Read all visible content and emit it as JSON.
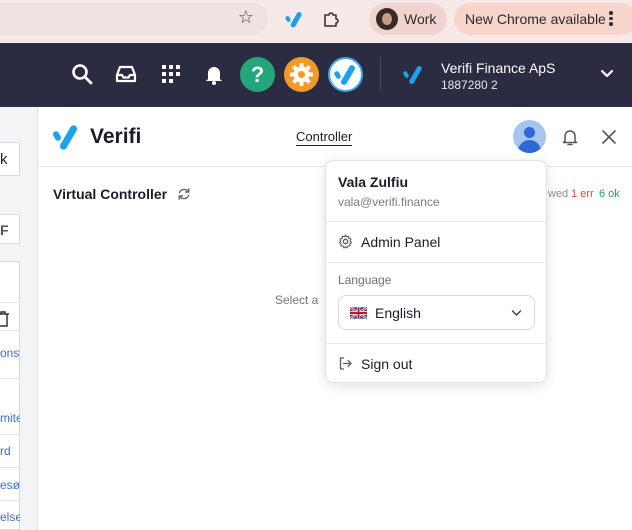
{
  "browser": {
    "profile_label": "Work",
    "update_label": "New Chrome available",
    "icons": [
      "bookmark-star-icon",
      "verifi-extension-icon",
      "extensions-puzzle-icon",
      "more-vert-icon"
    ]
  },
  "header": {
    "icons": [
      "search-icon",
      "inbox-icon",
      "apps-grid-icon",
      "bell-icon",
      "help-icon",
      "gear-icon",
      "verifi-icon"
    ],
    "help_glyph": "?",
    "company_name": "Verifi Finance ApS",
    "company_id": "1887280 2"
  },
  "left_panel": {
    "partial_texts": [
      "k",
      "F",
      "onsy",
      "mite",
      "rd",
      "esø",
      "else"
    ]
  },
  "main": {
    "brand_name": "Verifi",
    "tab_controller": "Controller",
    "title": "Virtual Controller",
    "status_viewed": "wed",
    "status_err": "1 err",
    "status_ok": "6 ok",
    "hint": "Select a"
  },
  "menu": {
    "user_name": "Vala Zulfiu",
    "user_email": "vala@verifi.finance",
    "admin_panel": "Admin Panel",
    "language_label": "Language",
    "language_value": "English",
    "sign_out": "Sign out"
  },
  "colors": {
    "header_bg": "#2b2b42",
    "brand_blue": "#1aa3ea",
    "help_green": "#24a67b",
    "gear_orange": "#f29a25",
    "error_red": "#e0443f",
    "ok_green": "#24a65d"
  }
}
